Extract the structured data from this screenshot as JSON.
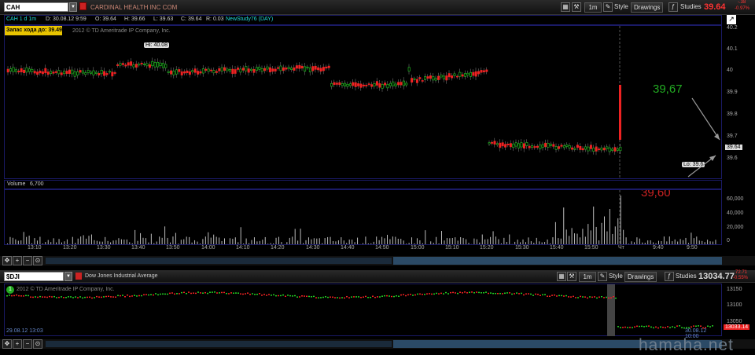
{
  "top": {
    "symbol": "CAH",
    "company": "CARDINAL HEALTH INC COM",
    "btn_1m": "1m",
    "style": "Style",
    "drawings": "Drawings",
    "studies": "Studies",
    "last": "39.64",
    "chg1": "-.38",
    "chg2": "-0.97%"
  },
  "info": {
    "title": "CAH 1 d 1m",
    "d": "D: 30.08.12 9:59",
    "o": "O: 39.64",
    "h": "H: 39.66",
    "l": "L: 39.63",
    "c": "C: 39.64",
    "r": "R: 0.03",
    "study": "NewStudy76 (DAY)"
  },
  "main": {
    "stop": "Запас хода до: 39.49",
    "copyright": "2012 © TD Ameritrade IP Company, Inc.",
    "hi": "Hi: 40.08",
    "lo": "Lo: 39.6",
    "price_box": "39.64",
    "ann_green": "39,67",
    "ann_red": "39,60",
    "yticks": [
      "40.2",
      "40.1",
      "40",
      "39.9",
      "39.8",
      "39.7",
      "39.6"
    ]
  },
  "volume": {
    "label": "Volume",
    "value": "6,700",
    "yticks": [
      "60,000",
      "40,000",
      "20,000",
      "0"
    ]
  },
  "xticks": [
    "13:10",
    "13:20",
    "13:30",
    "13:40",
    "13:50",
    "14:00",
    "14:10",
    "14:20",
    "14:30",
    "14:40",
    "14:50",
    "15:00",
    "15:10",
    "15:20",
    "15:30",
    "15:40",
    "15:50",
    "Чт",
    "9:40",
    "9:50"
  ],
  "bottom": {
    "symbol": "$DJI",
    "name": "Dow Jones Industrial Average",
    "btn_1m": "1m",
    "style": "Style",
    "drawings": "Drawings",
    "studies": "Studies",
    "last": "13034.77",
    "chg1": "72.71",
    "chg2": "-0.55%",
    "copyright": "2012 © TD Ameritrade IP Company, Inc.",
    "badge": "1",
    "yticks": [
      "13150",
      "13100",
      "13050"
    ],
    "price_box": "13033.14",
    "date_left": "29.08.12 13:03",
    "date_right": "30.08.12 10:00"
  },
  "watermark": "hamaha.net",
  "colors": {
    "up": "#22cc22",
    "down": "#ee2222",
    "accent": "#ff3333",
    "panel_border": "#1a1a66"
  }
}
